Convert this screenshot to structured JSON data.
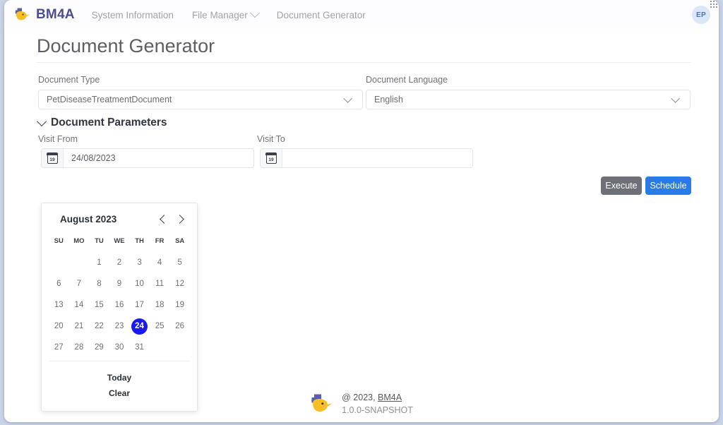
{
  "navbar": {
    "brand": "BM4A",
    "brand_logo_icon": "bee-logo-icon",
    "links": [
      {
        "label": "System Information",
        "has_chevron": false
      },
      {
        "label": "File Manager",
        "has_chevron": true
      },
      {
        "label": "Document Generator",
        "has_chevron": false
      }
    ],
    "avatar_initials": "EP"
  },
  "page": {
    "title": "Document Generator"
  },
  "form": {
    "document_type": {
      "label": "Document Type",
      "value": "PetDiseaseTreatmentDocument"
    },
    "document_language": {
      "label": "Document Language",
      "value": "English"
    },
    "parameters_section": {
      "title": "Document Parameters"
    },
    "visit_from": {
      "label": "Visit From",
      "value": "24/08/2023",
      "placeholder": "",
      "icon": "calendar-icon",
      "icon_day": "19"
    },
    "visit_to": {
      "label": "Visit To",
      "value": "",
      "placeholder": "",
      "icon": "calendar-icon",
      "icon_day": "19"
    }
  },
  "datepicker": {
    "month_label": "August 2023",
    "prev_icon": "chevron-left-icon",
    "next_icon": "chevron-right-icon",
    "weekdays": [
      "SU",
      "MO",
      "TU",
      "WE",
      "TH",
      "FR",
      "SA"
    ],
    "weeks": [
      [
        "",
        "",
        "1",
        "2",
        "3",
        "4",
        "5"
      ],
      [
        "6",
        "7",
        "8",
        "9",
        "10",
        "11",
        "12"
      ],
      [
        "13",
        "14",
        "15",
        "16",
        "17",
        "18",
        "19"
      ],
      [
        "20",
        "21",
        "22",
        "23",
        "24",
        "25",
        "26"
      ],
      [
        "27",
        "28",
        "29",
        "30",
        "31",
        "",
        ""
      ]
    ],
    "selected_day": "24",
    "today_label": "Today",
    "clear_label": "Clear",
    "selected_color": "#1a1af0"
  },
  "actions": {
    "execute_label": "Execute",
    "schedule_label": "Schedule",
    "execute_color": "#6d7177",
    "schedule_color": "#2a7aea"
  },
  "footer": {
    "logo_icon": "bee-logo-icon",
    "copyright_prefix": "@ 2023, ",
    "copyright_brand": "BM4A",
    "version": "1.0.0-SNAPSHOT"
  }
}
